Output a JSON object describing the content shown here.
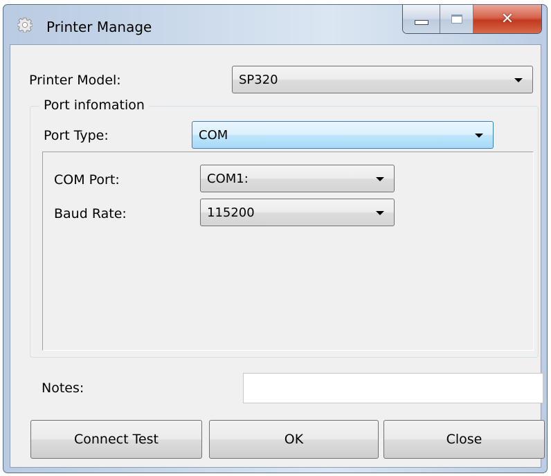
{
  "window": {
    "title": "Printer Manage",
    "icon": "gear-icon",
    "controls": {
      "minimize": "minimize-icon",
      "maximize": "maximize-icon",
      "close": "✕"
    }
  },
  "form": {
    "printer_model_label": "Printer Model:",
    "printer_model_value": "SP320",
    "port_group_title": "Port infomation",
    "port_type_label": "Port Type:",
    "port_type_value": "COM",
    "com_port_label": "COM Port:",
    "com_port_value": "COM1:",
    "baud_rate_label": "Baud Rate:",
    "baud_rate_value": "115200",
    "notes_label": "Notes:",
    "notes_value": ""
  },
  "buttons": {
    "connect_test": "Connect Test",
    "ok": "OK",
    "close": "Close"
  },
  "colors": {
    "titlebar": "#c9d8ea",
    "client_bg": "#f0f0f0",
    "focus_border": "#3c7fb1",
    "close_button": "#c23a1e"
  }
}
